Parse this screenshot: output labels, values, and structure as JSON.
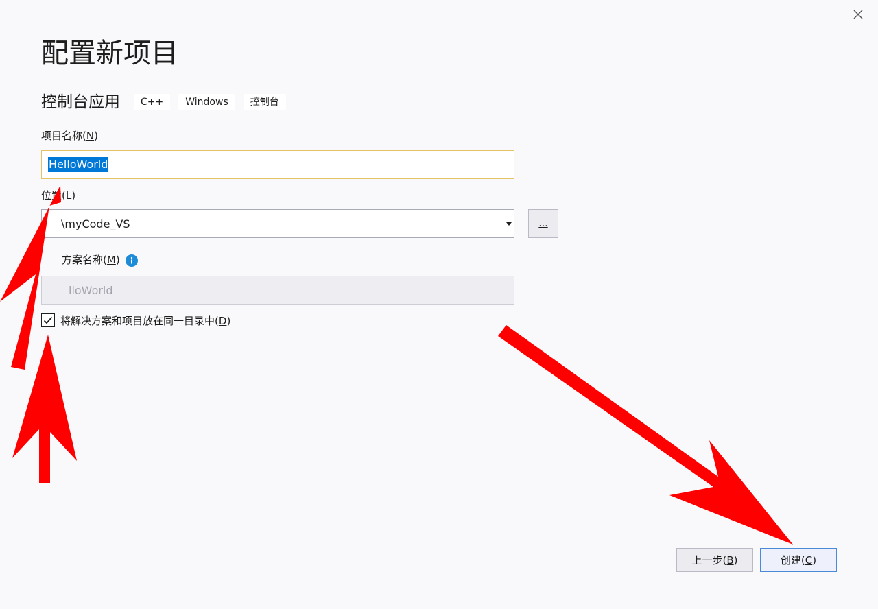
{
  "dialog": {
    "title": "配置新项目",
    "close_icon": "close-icon"
  },
  "template": {
    "name": "控制台应用",
    "tags": [
      "C++",
      "Windows",
      "控制台"
    ]
  },
  "project_name": {
    "label": "项目名称",
    "mnemonic": "N",
    "value": "HelloWorld"
  },
  "location": {
    "label": "位置",
    "mnemonic": "L",
    "value": "\\myCode_VS",
    "browse_label": "..."
  },
  "solution_name": {
    "label": "方案名称",
    "mnemonic": "M",
    "value": "lloWorld",
    "info_icon": "info-icon"
  },
  "same_dir": {
    "checked": true,
    "label": "将解决方案和项目放在同一目录中",
    "mnemonic": "D"
  },
  "footer": {
    "back_label": "上一步",
    "back_mnemonic": "B",
    "create_label": "创建",
    "create_mnemonic": "C"
  },
  "colors": {
    "selection": "#0078d7",
    "focus_border": "#e5c365",
    "info": "#1e8bd8",
    "annotation_arrow": "#ff0000"
  }
}
